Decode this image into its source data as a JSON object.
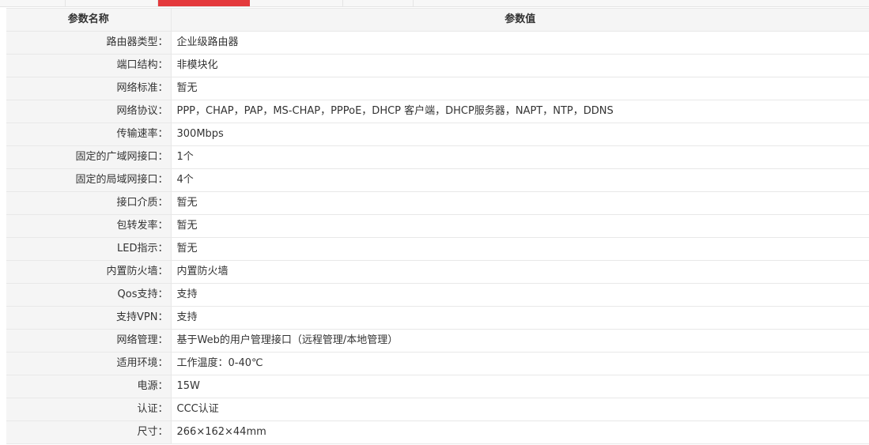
{
  "table": {
    "header_name": "参数名称",
    "header_value": "参数值",
    "rows": [
      {
        "name": "路由器类型：",
        "value": "企业级路由器"
      },
      {
        "name": "端口结构：",
        "value": "非模块化"
      },
      {
        "name": "网络标准：",
        "value": "暂无"
      },
      {
        "name": "网络协议：",
        "value": "PPP，CHAP，PAP，MS-CHAP，PPPoE，DHCP 客户端，DHCP服务器，NAPT，NTP，DDNS"
      },
      {
        "name": "传输速率：",
        "value": "300Mbps"
      },
      {
        "name": "固定的广域网接口：",
        "value": "1个"
      },
      {
        "name": "固定的局域网接口：",
        "value": "4个"
      },
      {
        "name": "接口介质：",
        "value": "暂无"
      },
      {
        "name": "包转发率：",
        "value": "暂无"
      },
      {
        "name": "LED指示：",
        "value": "暂无"
      },
      {
        "name": "内置防火墙：",
        "value": "内置防火墙"
      },
      {
        "name": "Qos支持：",
        "value": "支持"
      },
      {
        "name": "支持VPN：",
        "value": "支持"
      },
      {
        "name": "网络管理：",
        "value": "基于Web的用户管理接口（远程管理/本地管理）"
      },
      {
        "name": "适用环境：",
        "value": "工作温度：0-40℃"
      },
      {
        "name": "电源：",
        "value": "15W"
      },
      {
        "name": "认证：",
        "value": "CCC认证"
      },
      {
        "name": "尺寸：",
        "value": "266×162×44mm"
      }
    ]
  },
  "colors": {
    "active_tab": "#e4393c",
    "label_bg": "#f5f5f5",
    "border": "#e8e8e8"
  }
}
